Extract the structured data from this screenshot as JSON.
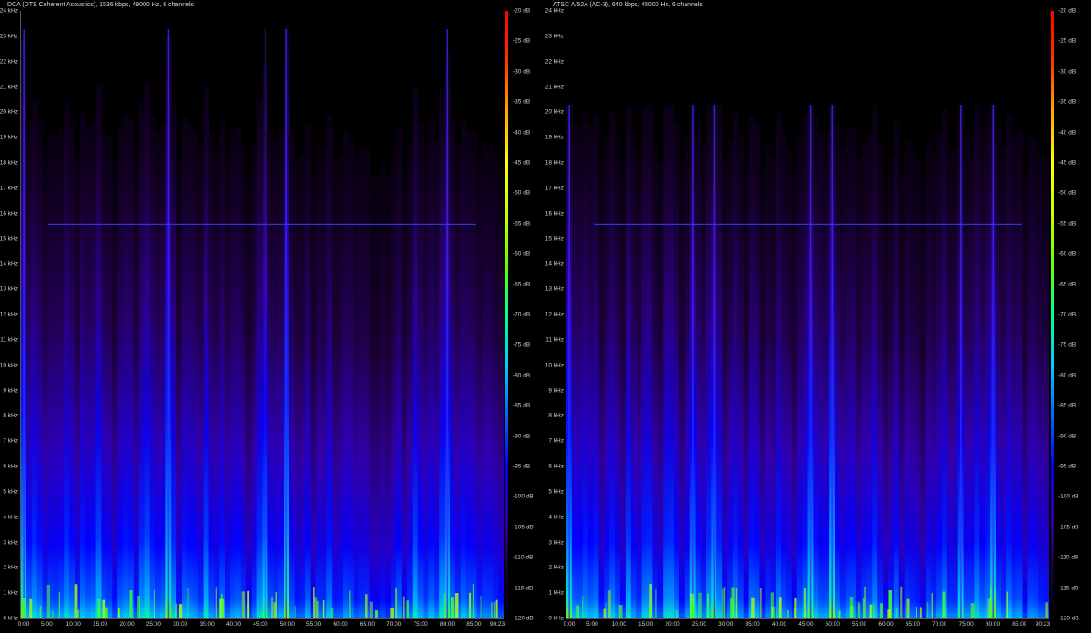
{
  "chart_data": [
    {
      "type": "heatmap",
      "title": "DCA (DTS Coherent Acoustics), 1536 kbps, 48000 Hz, 6 channels",
      "y_ticks": [
        "0 kHz",
        "1 kHz",
        "2 kHz",
        "3 kHz",
        "4 kHz",
        "5 kHz",
        "6 kHz",
        "7 kHz",
        "8 kHz",
        "9 kHz",
        "10 kHz",
        "11 kHz",
        "12 kHz",
        "13 kHz",
        "14 kHz",
        "15 kHz",
        "16 kHz",
        "17 kHz",
        "18 kHz",
        "19 kHz",
        "20 kHz",
        "21 kHz",
        "22 kHz",
        "23 kHz",
        "24 kHz"
      ],
      "x_ticks": [
        "0:00",
        "5:00",
        "10:00",
        "15:00",
        "20:00",
        "25:00",
        "30:00",
        "35:00",
        "40:00",
        "45:00",
        "50:00",
        "55:00",
        "60:00",
        "65:00",
        "70:00",
        "75:00",
        "80:00",
        "85:00",
        "90:23"
      ],
      "db_ticks": [
        "-20 dB",
        "-25 dB",
        "-30 dB",
        "-35 dB",
        "-40 dB",
        "-45 dB",
        "-50 dB",
        "-55 dB",
        "-60 dB",
        "-65 dB",
        "-70 dB",
        "-75 dB",
        "-80 dB",
        "-85 dB",
        "-90 dB",
        "-95 dB",
        "-100 dB",
        "-105 dB",
        "-110 dB",
        "-115 dB",
        "-120 dB"
      ],
      "ylim_khz": [
        0,
        24
      ],
      "db_range": [
        -120,
        -20
      ],
      "duration_minutes": 90.38,
      "cutoff_khz": 24,
      "line_khz": 15.6,
      "intensity_profile": [
        0.85,
        0.5,
        0.55,
        0.6,
        0.5,
        0.55,
        0.45,
        0.5,
        0.55,
        0.5,
        0.45,
        0.6,
        0.55,
        0.5,
        0.6,
        0.55,
        0.5,
        0.45,
        0.55,
        0.6,
        0.5,
        0.45,
        0.55,
        0.7,
        0.5,
        0.45,
        0.55,
        0.8,
        0.6,
        0.45,
        0.5,
        0.55,
        0.45,
        0.4,
        0.6,
        0.55,
        0.4,
        0.5,
        0.45,
        0.55,
        0.5,
        0.45,
        0.4,
        0.5,
        0.55,
        0.75,
        0.5,
        0.45,
        0.5,
        0.85,
        0.5,
        0.4,
        0.45,
        0.5,
        0.4,
        0.45,
        0.5,
        0.55,
        0.45,
        0.4,
        0.45,
        0.5,
        0.4,
        0.45,
        0.5,
        0.4,
        0.35,
        0.45,
        0.4,
        0.45,
        0.55,
        0.4,
        0.45,
        0.7,
        0.5,
        0.45,
        0.55,
        0.5,
        0.6,
        0.8,
        0.55,
        0.45,
        0.5,
        0.45,
        0.5,
        0.4,
        0.45,
        0.5,
        0.45,
        0.4
      ]
    },
    {
      "type": "heatmap",
      "title": "ATSC A/52A (AC-3), 640 kbps, 48000 Hz, 6 channels",
      "y_ticks": [
        "0 kHz",
        "1 kHz",
        "2 kHz",
        "3 kHz",
        "4 kHz",
        "5 kHz",
        "6 kHz",
        "7 kHz",
        "8 kHz",
        "9 kHz",
        "10 kHz",
        "11 kHz",
        "12 kHz",
        "13 kHz",
        "14 kHz",
        "15 kHz",
        "16 kHz",
        "17 kHz",
        "18 kHz",
        "19 kHz",
        "20 kHz",
        "21 kHz",
        "22 kHz",
        "23 kHz",
        "24 kHz"
      ],
      "x_ticks": [
        "0:00",
        "5:00",
        "10:00",
        "15:00",
        "20:00",
        "25:00",
        "30:00",
        "35:00",
        "40:00",
        "45:00",
        "50:00",
        "55:00",
        "60:00",
        "65:00",
        "70:00",
        "75:00",
        "80:00",
        "85:00",
        "90:23"
      ],
      "db_ticks": [
        "-20 dB",
        "-25 dB",
        "-30 dB",
        "-35 dB",
        "-40 dB",
        "-45 dB",
        "-50 dB",
        "-55 dB",
        "-60 dB",
        "-65 dB",
        "-70 dB",
        "-75 dB",
        "-80 dB",
        "-85 dB",
        "-90 dB",
        "-95 dB",
        "-100 dB",
        "-105 dB",
        "-110 dB",
        "-115 dB",
        "-120 dB"
      ],
      "ylim_khz": [
        0,
        24
      ],
      "db_range": [
        -120,
        -20
      ],
      "duration_minutes": 90.38,
      "cutoff_khz": 20.3,
      "line_khz": 15.6,
      "intensity_profile": [
        0.85,
        0.5,
        0.55,
        0.6,
        0.5,
        0.55,
        0.45,
        0.5,
        0.55,
        0.5,
        0.45,
        0.6,
        0.55,
        0.5,
        0.6,
        0.55,
        0.5,
        0.45,
        0.55,
        0.6,
        0.5,
        0.45,
        0.55,
        0.7,
        0.5,
        0.45,
        0.55,
        0.8,
        0.6,
        0.45,
        0.5,
        0.55,
        0.45,
        0.4,
        0.6,
        0.55,
        0.4,
        0.5,
        0.45,
        0.55,
        0.5,
        0.45,
        0.4,
        0.5,
        0.55,
        0.75,
        0.5,
        0.45,
        0.5,
        0.85,
        0.5,
        0.4,
        0.45,
        0.5,
        0.4,
        0.45,
        0.5,
        0.55,
        0.45,
        0.4,
        0.45,
        0.5,
        0.4,
        0.45,
        0.5,
        0.4,
        0.35,
        0.45,
        0.4,
        0.45,
        0.55,
        0.4,
        0.45,
        0.7,
        0.5,
        0.45,
        0.55,
        0.5,
        0.6,
        0.8,
        0.55,
        0.45,
        0.5,
        0.45,
        0.5,
        0.4,
        0.45,
        0.5,
        0.45,
        0.4
      ]
    }
  ],
  "colorbar_stops": [
    "#000000",
    "#1a0033",
    "#3300aa",
    "#0000ff",
    "#0066ff",
    "#00ccff",
    "#00ff99",
    "#66ff00",
    "#ccff00",
    "#ffff00",
    "#ffaa00",
    "#ff3300",
    "#ff0000"
  ]
}
